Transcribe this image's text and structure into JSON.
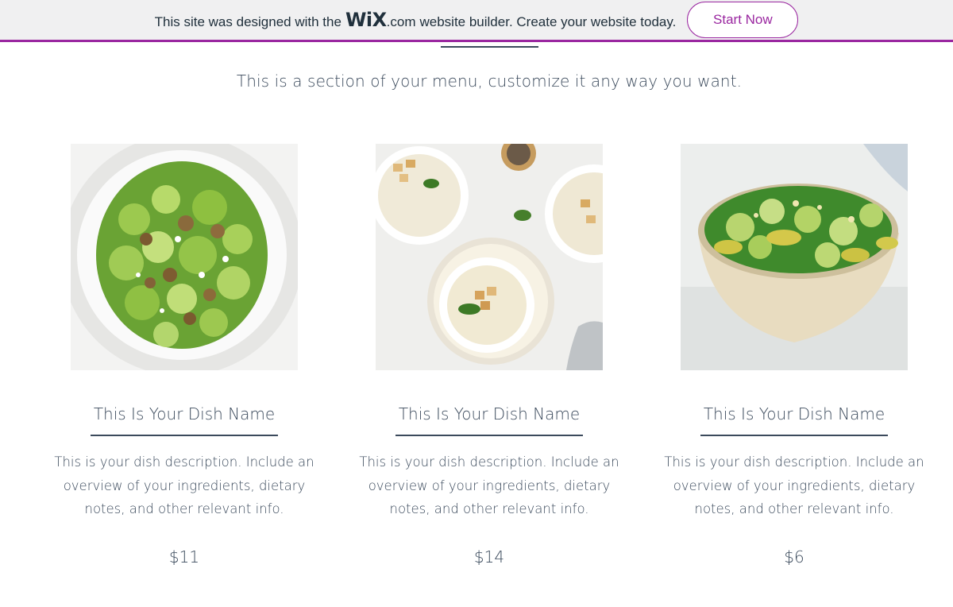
{
  "banner": {
    "text_before": "This site was designed with the",
    "logo": "WiX",
    "logo_suffix": ".com",
    "text_after": "website builder. Create your website today.",
    "button_label": "Start Now",
    "accent_color": "#9a27a0"
  },
  "section": {
    "intro": "This is a section of your menu, customize it any way you want."
  },
  "dishes": [
    {
      "image": "brussels-sprouts-salad-photo",
      "name": "This Is Your Dish Name",
      "description": "This is your dish description. Include an overview of your ingredients, dietary notes, and other relevant info.",
      "price": "$11"
    },
    {
      "image": "cream-soup-with-croutons-photo",
      "name": "This Is Your Dish Name",
      "description": "This is your dish description. Include an overview of your ingredients, dietary notes, and other relevant info.",
      "price": "$14"
    },
    {
      "image": "green-salad-bowl-photo",
      "name": "This Is Your Dish Name",
      "description": "This is your dish description. Include an overview of your ingredients, dietary notes, and other relevant info.",
      "price": "$6"
    }
  ]
}
